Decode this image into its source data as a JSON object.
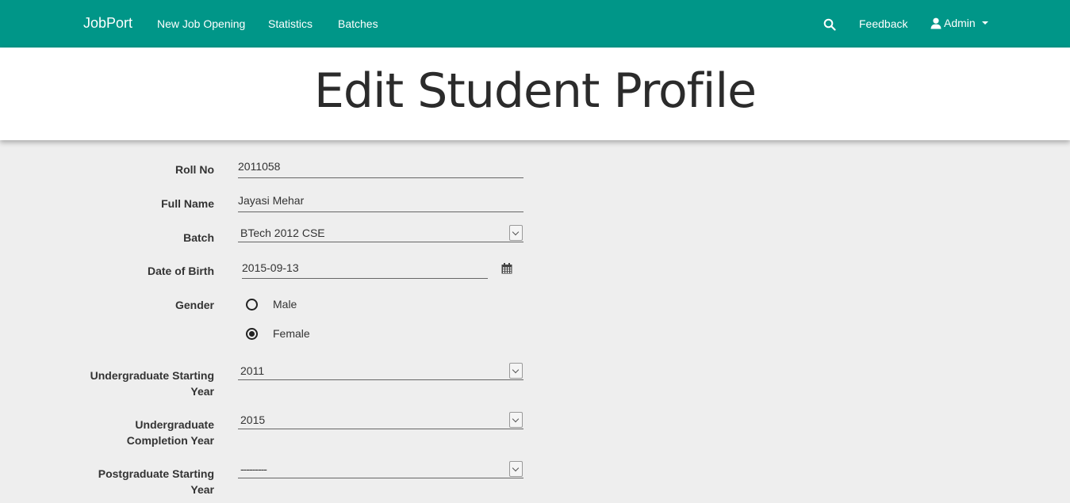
{
  "navbar": {
    "brand": "JobPort",
    "links": [
      "New Job Opening",
      "Statistics",
      "Batches"
    ],
    "feedback": "Feedback",
    "user": "Admin"
  },
  "header": {
    "title": "Edit Student Profile"
  },
  "form": {
    "roll_no": {
      "label": "Roll No",
      "value": "2011058"
    },
    "full_name": {
      "label": "Full Name",
      "value": "Jayasi Mehar"
    },
    "batch": {
      "label": "Batch",
      "value": "BTech 2012 CSE"
    },
    "dob": {
      "label": "Date of Birth",
      "value": "2015-09-13"
    },
    "gender": {
      "label": "Gender",
      "options": [
        "Male",
        "Female"
      ],
      "selected": "Female"
    },
    "ug_start": {
      "label_line1": "Undergraduate Starting",
      "label_line2": "Year",
      "value": "2011"
    },
    "ug_end": {
      "label_line1": "Undergraduate",
      "label_line2": "Completion Year",
      "value": "2015"
    },
    "pg_start": {
      "label_line1": "Postgraduate Starting",
      "label_line2": "Year",
      "value": "---------"
    }
  }
}
